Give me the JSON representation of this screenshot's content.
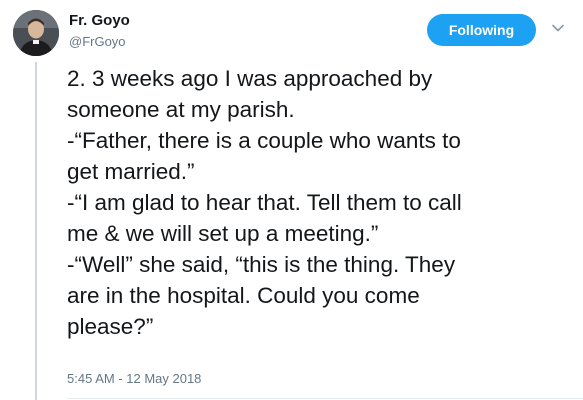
{
  "author": {
    "name": "Fr. Goyo",
    "handle": "@FrGoyo",
    "avatar_icon": "profile-photo"
  },
  "follow_button": {
    "label": "Following",
    "color": "#1da1f2"
  },
  "menu": {
    "icon": "chevron-down-icon"
  },
  "tweet": {
    "lines": [
      "2. 3 weeks ago I was approached by",
      "someone at my parish.",
      "-“Father, there is a couple who wants to",
      "get married.”",
      "-“I am glad to hear that. Tell them to call",
      "me & we will set up a meeting.”",
      "-“Well” she said, “this is the thing. They",
      "are in the hospital. Could you come",
      "please?”"
    ],
    "timestamp": "5:45 AM - 12 May 2018"
  },
  "colors": {
    "text": "#14171a",
    "secondary": "#657786",
    "thread_line": "#ccd6dd"
  }
}
